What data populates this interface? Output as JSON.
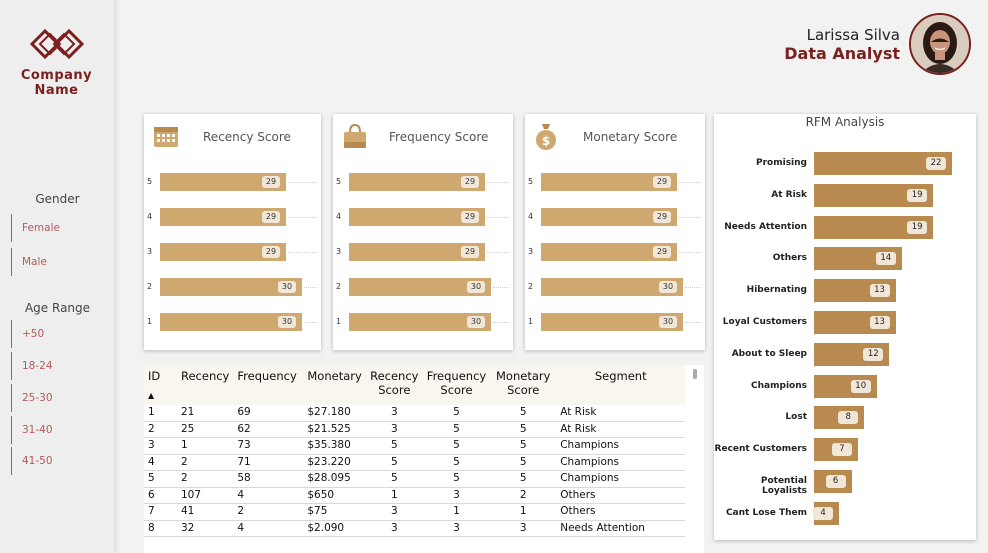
{
  "sidebar": {
    "company_line1": "Company",
    "company_line2": "Name",
    "gender_title": "Gender",
    "gender_items": [
      "Female",
      "Male"
    ],
    "age_title": "Age Range",
    "age_items": [
      "+50",
      "18-24",
      "25-30",
      "31-40",
      "41-50"
    ]
  },
  "profile": {
    "name": "Larissa Silva",
    "role": "Data Analyst"
  },
  "colors": {
    "accent": "#7b1f1f",
    "score_bar": "#cfa86f",
    "rfm_bar": "#b88a50"
  },
  "cards": [
    {
      "title": "Recency Score",
      "icon": "calendar-icon",
      "rows": [
        {
          "label": "5",
          "value": 29
        },
        {
          "label": "4",
          "value": 29
        },
        {
          "label": "3",
          "value": 29
        },
        {
          "label": "2",
          "value": 30
        },
        {
          "label": "1",
          "value": 30
        }
      ]
    },
    {
      "title": "Frequency Score",
      "icon": "shopping-bag-icon",
      "rows": [
        {
          "label": "5",
          "value": 29
        },
        {
          "label": "4",
          "value": 29
        },
        {
          "label": "3",
          "value": 29
        },
        {
          "label": "2",
          "value": 30
        },
        {
          "label": "1",
          "value": 30
        }
      ]
    },
    {
      "title": "Monetary Score",
      "icon": "money-bag-icon",
      "rows": [
        {
          "label": "5",
          "value": 29
        },
        {
          "label": "4",
          "value": 29
        },
        {
          "label": "3",
          "value": 29
        },
        {
          "label": "2",
          "value": 30
        },
        {
          "label": "1",
          "value": 30
        }
      ]
    }
  ],
  "rfm": {
    "title": "RFM Analysis",
    "items": [
      {
        "label": "Promising",
        "value": 22
      },
      {
        "label": "At Risk",
        "value": 19
      },
      {
        "label": "Needs Attention",
        "value": 19
      },
      {
        "label": "Others",
        "value": 14
      },
      {
        "label": "Hibernating",
        "value": 13
      },
      {
        "label": "Loyal Customers",
        "value": 13
      },
      {
        "label": "About to Sleep",
        "value": 12
      },
      {
        "label": "Champions",
        "value": 10
      },
      {
        "label": "Lost",
        "value": 8
      },
      {
        "label": "Recent Customers",
        "value": 7
      },
      {
        "label": "Potential Loyalists",
        "value": 6
      },
      {
        "label": "Cant Lose Them",
        "value": 4
      }
    ]
  },
  "table": {
    "headers": [
      "ID",
      "Recency",
      "Frequency",
      "Monetary",
      "Recency Score",
      "Frequency Score",
      "Monetary Score",
      "Segment"
    ],
    "sort_indicator": "▲",
    "rows": [
      [
        "1",
        "21",
        "69",
        "$27.180",
        "3",
        "5",
        "5",
        "At Risk"
      ],
      [
        "2",
        "25",
        "62",
        "$21.525",
        "3",
        "5",
        "5",
        "At Risk"
      ],
      [
        "3",
        "1",
        "73",
        "$35.380",
        "5",
        "5",
        "5",
        "Champions"
      ],
      [
        "4",
        "2",
        "71",
        "$23.220",
        "5",
        "5",
        "5",
        "Champions"
      ],
      [
        "5",
        "2",
        "58",
        "$28.095",
        "5",
        "5",
        "5",
        "Champions"
      ],
      [
        "6",
        "107",
        "4",
        "$650",
        "1",
        "3",
        "2",
        "Others"
      ],
      [
        "7",
        "41",
        "2",
        "$75",
        "3",
        "1",
        "1",
        "Others"
      ],
      [
        "8",
        "32",
        "4",
        "$2.090",
        "3",
        "3",
        "3",
        "Needs Attention"
      ]
    ]
  }
}
